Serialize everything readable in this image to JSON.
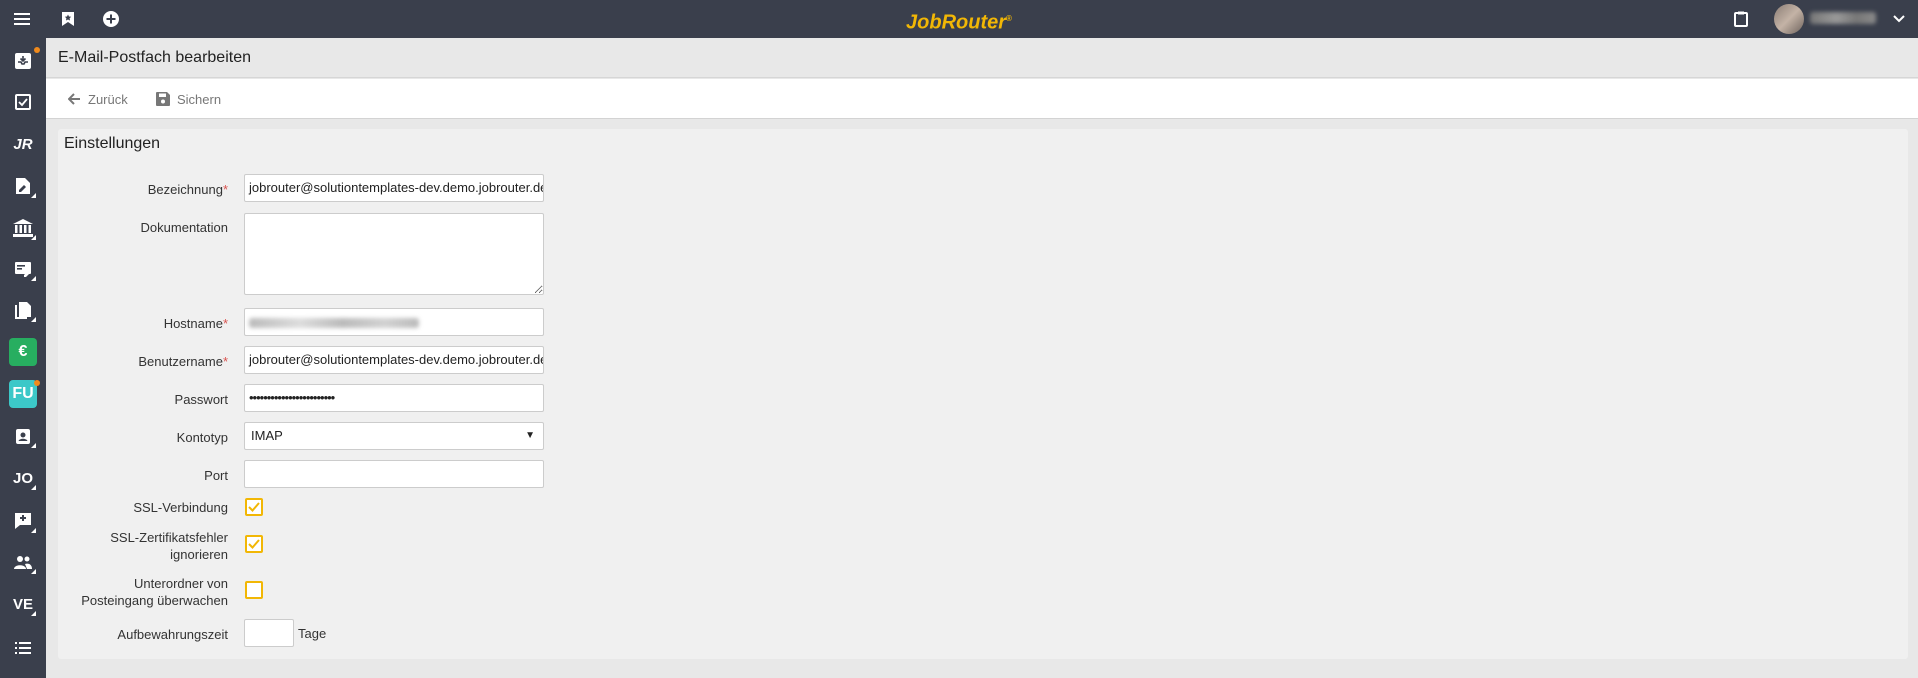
{
  "app": {
    "brand": "JobRouter",
    "brand_mark": "®",
    "accent_color": "#f2b705",
    "topbar_icons": [
      "menu-icon",
      "bookmark-icon",
      "add-circle-icon",
      "clipboard-icon",
      "chevron-down-icon"
    ]
  },
  "sidebar": {
    "items": [
      {
        "name": "inbox",
        "icon": "inbox-icon",
        "badge_dot": true
      },
      {
        "name": "tasks",
        "icon": "task-check-icon"
      },
      {
        "name": "jr",
        "text": "JR"
      },
      {
        "name": "documents",
        "icon": "document-edit-icon"
      },
      {
        "name": "bank",
        "icon": "bank-icon"
      },
      {
        "name": "forms",
        "icon": "form-icon"
      },
      {
        "name": "files",
        "icon": "files-icon"
      },
      {
        "name": "euro",
        "text": "€",
        "color": "#27ae60"
      },
      {
        "name": "fu",
        "text": "FU",
        "color": "#3cc8c8",
        "badge_dot": true
      },
      {
        "name": "contacts",
        "icon": "contact-icon"
      },
      {
        "name": "jo",
        "text": "JO"
      },
      {
        "name": "feedback",
        "icon": "feedback-icon"
      },
      {
        "name": "users",
        "icon": "users-icon"
      },
      {
        "name": "ve",
        "text": "VE"
      },
      {
        "name": "list",
        "icon": "list-icon"
      }
    ]
  },
  "page": {
    "title": "E-Mail-Postfach bearbeiten"
  },
  "toolbar": {
    "back_label": "Zurück",
    "save_label": "Sichern"
  },
  "settings": {
    "title": "Einstellungen",
    "bezeichnung": {
      "label": "Bezeichnung",
      "required": "*",
      "value": "jobrouter@solutiontemplates-dev.demo.jobrouter.de"
    },
    "dokumentation": {
      "label": "Dokumentation",
      "value": ""
    },
    "hostname": {
      "label": "Hostname",
      "required": "*"
    },
    "benutzername": {
      "label": "Benutzername",
      "required": "*",
      "value": "jobrouter@solutiontemplates-dev.demo.jobrouter.de"
    },
    "passwort": {
      "label": "Passwort",
      "value": "••••••••••••••••••••••••"
    },
    "kontotyp": {
      "label": "Kontotyp",
      "value": "IMAP"
    },
    "port": {
      "label": "Port",
      "value": ""
    },
    "ssl": {
      "label": "SSL-Verbindung",
      "checked": true
    },
    "ssl_errors": {
      "label_line1": "SSL-Zertifikatsfehler",
      "label_line2": "ignorieren",
      "checked": true
    },
    "subfolders": {
      "label_line1": "Unterordner von",
      "label_line2": "Posteingang überwachen",
      "checked": false
    },
    "retention": {
      "label": "Aufbewahrungszeit",
      "value": "",
      "unit": "Tage"
    }
  }
}
